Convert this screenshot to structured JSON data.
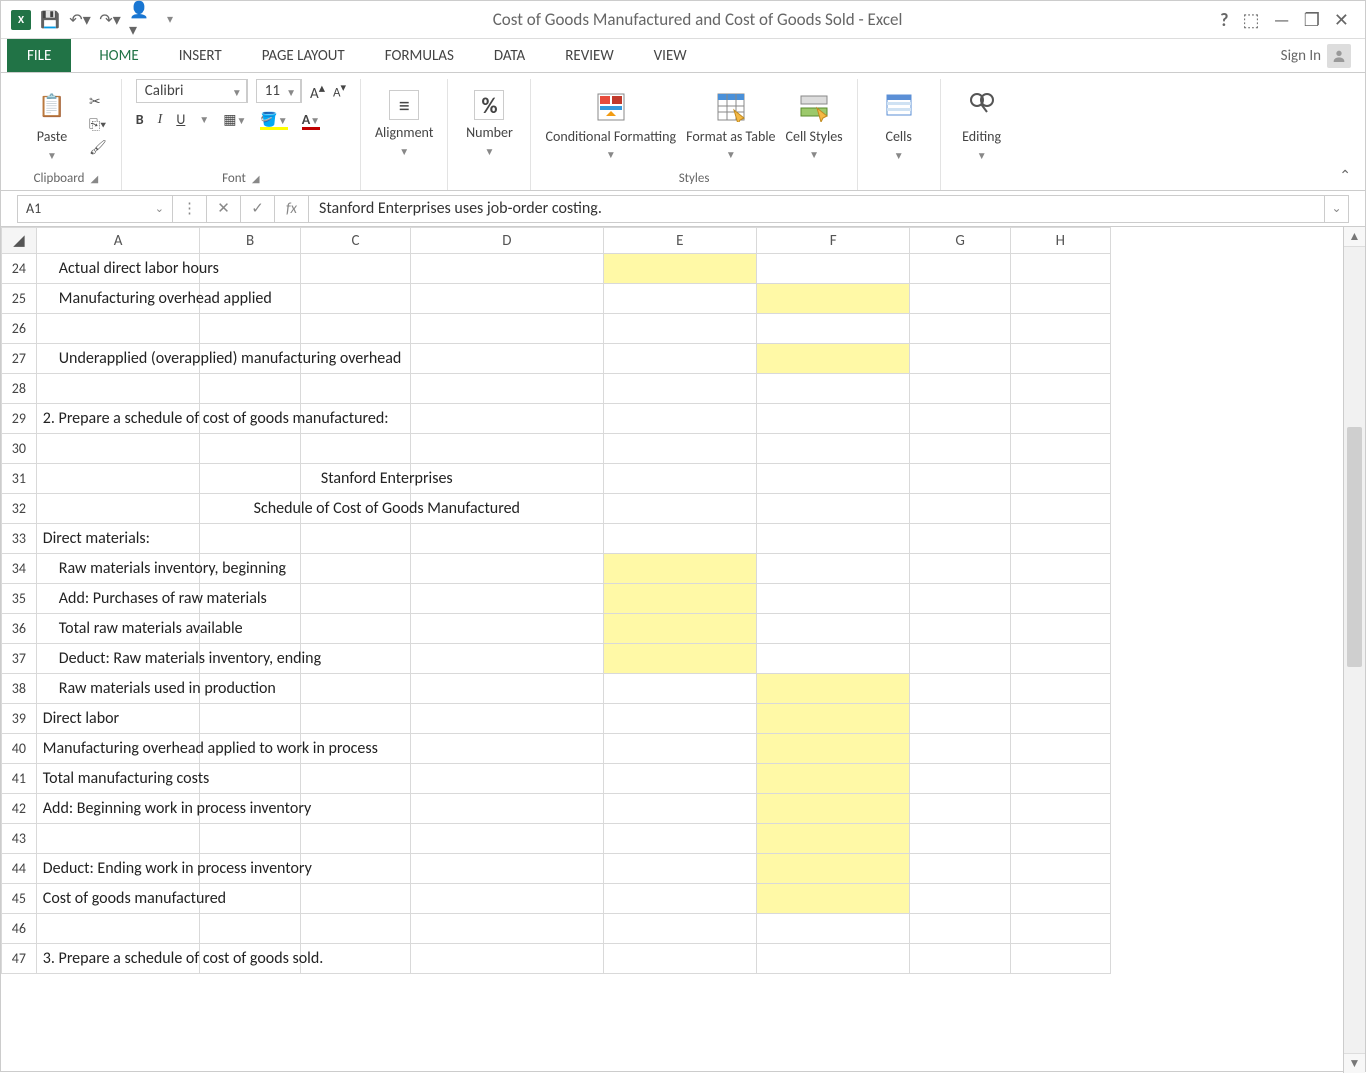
{
  "titlebar": {
    "title": "Cost of Goods Manufactured and Cost of Goods Sold - Excel"
  },
  "tabs": {
    "file": "FILE",
    "home": "HOME",
    "insert": "INSERT",
    "pagelayout": "PAGE LAYOUT",
    "formulas": "FORMULAS",
    "data": "DATA",
    "review": "REVIEW",
    "view": "VIEW",
    "signin": "Sign In"
  },
  "ribbon": {
    "clipboard": {
      "paste": "Paste",
      "label": "Clipboard"
    },
    "font": {
      "name": "Calibri",
      "size": "11",
      "label": "Font"
    },
    "alignment": {
      "label": "Alignment"
    },
    "number": {
      "label": "Number"
    },
    "styles": {
      "cond": "Conditional Formatting",
      "fat": "Format as Table",
      "cell": "Cell Styles",
      "label": "Styles"
    },
    "cells": {
      "label": "Cells"
    },
    "editing": {
      "label": "Editing"
    }
  },
  "namebox": {
    "ref": "A1"
  },
  "formula_bar": {
    "text": "Stanford Enterprises uses job-order costing."
  },
  "columns": {
    "A": "A",
    "B": "B",
    "C": "C",
    "D": "D",
    "E": "E",
    "F": "F",
    "G": "G",
    "H": "H"
  },
  "rows": [
    {
      "n": "24",
      "text": "Actual direct labor hours",
      "indent": true,
      "hl": [
        "E"
      ]
    },
    {
      "n": "25",
      "text": "Manufacturing overhead applied",
      "indent": true,
      "hl": [
        "F"
      ]
    },
    {
      "n": "26",
      "text": "",
      "indent": false,
      "hl": []
    },
    {
      "n": "27",
      "text": "Underapplied (overapplied) manufacturing overhead",
      "indent": true,
      "hl": [
        "F"
      ]
    },
    {
      "n": "28",
      "text": "",
      "indent": false,
      "hl": []
    },
    {
      "n": "29",
      "text": "2. Prepare a schedule of cost of goods manufactured:",
      "indent": false,
      "hl": []
    },
    {
      "n": "30",
      "text": "",
      "indent": false,
      "hl": []
    },
    {
      "n": "31",
      "text": "Stanford Enterprises",
      "indent": false,
      "center": true,
      "hl": []
    },
    {
      "n": "32",
      "text": "Schedule of Cost of Goods Manufactured",
      "indent": false,
      "center": true,
      "hl": []
    },
    {
      "n": "33",
      "text": "Direct materials:",
      "indent": false,
      "hl": []
    },
    {
      "n": "34",
      "text": "Raw materials inventory, beginning",
      "indent": true,
      "hl": [
        "E"
      ]
    },
    {
      "n": "35",
      "text": "Add: Purchases of raw materials",
      "indent": true,
      "hl": [
        "E"
      ]
    },
    {
      "n": "36",
      "text": "Total raw materials available",
      "indent": true,
      "hl": [
        "E"
      ]
    },
    {
      "n": "37",
      "text": "Deduct: Raw materials inventory, ending",
      "indent": true,
      "hl": [
        "E"
      ]
    },
    {
      "n": "38",
      "text": "Raw materials used in production",
      "indent": true,
      "hl": [
        "F"
      ]
    },
    {
      "n": "39",
      "text": "Direct labor",
      "indent": false,
      "hl": [
        "F"
      ]
    },
    {
      "n": "40",
      "text": "Manufacturing overhead applied to work in process",
      "indent": false,
      "hl": [
        "F"
      ]
    },
    {
      "n": "41",
      "text": "Total manufacturing costs",
      "indent": false,
      "hl": [
        "F"
      ]
    },
    {
      "n": "42",
      "text": "Add: Beginning work in process inventory",
      "indent": false,
      "hl": [
        "F"
      ]
    },
    {
      "n": "43",
      "text": "",
      "indent": false,
      "hl": [
        "F"
      ]
    },
    {
      "n": "44",
      "text": "Deduct: Ending work in process inventory",
      "indent": false,
      "hl": [
        "F"
      ]
    },
    {
      "n": "45",
      "text": "Cost of goods manufactured",
      "indent": false,
      "hl": [
        "F"
      ]
    },
    {
      "n": "46",
      "text": "",
      "indent": false,
      "hl": []
    },
    {
      "n": "47",
      "text": "3. Prepare a schedule of cost of goods sold.",
      "indent": false,
      "hl": []
    }
  ]
}
